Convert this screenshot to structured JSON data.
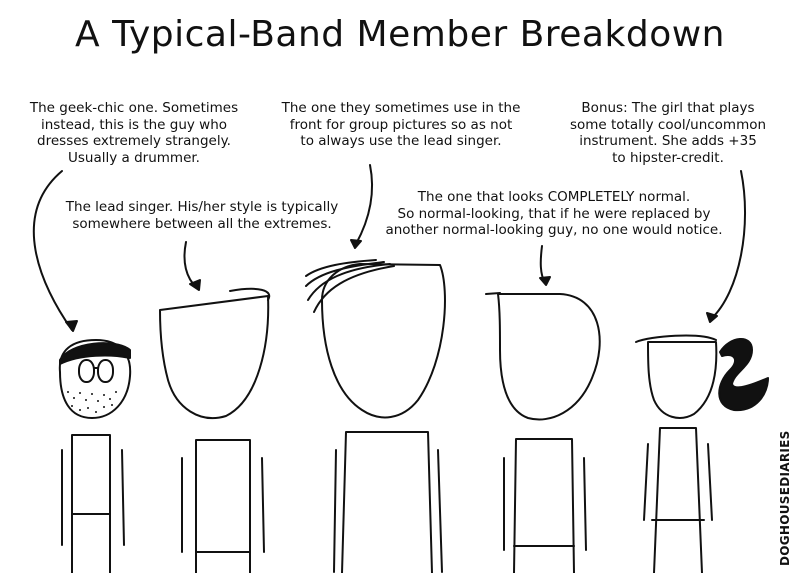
{
  "title": "A Typical-Band Member Breakdown",
  "notes": {
    "geek": "The geek-chic one. Sometimes\ninstead, this is the guy who\ndresses extremely strangely.\nUsually a drummer.",
    "lead": "The lead singer. His/her style is typically\nsomewhere between all the extremes.",
    "front": "The one they sometimes use in the\nfront for group pictures so as not\nto always use the lead singer.",
    "normal": "The one that looks COMPLETELY normal.\nSo normal-looking, that if he were replaced by\nanother normal-looking guy, no one would notice.",
    "bonus": "Bonus: The girl that plays\nsome totally cool/uncommon\ninstrument. She adds +35\nto hipster-credit."
  },
  "credit": "DOGHOUSEDIARIES"
}
